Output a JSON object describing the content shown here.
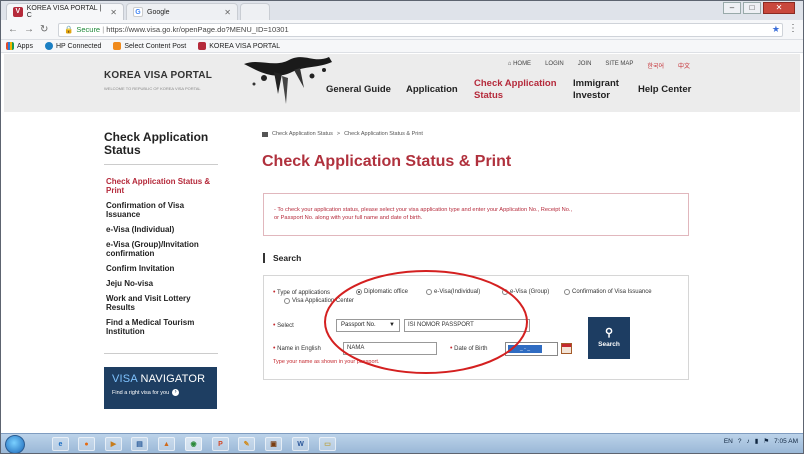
{
  "browser": {
    "tabs": [
      {
        "title": "KOREA VISA PORTAL | C",
        "favicon": "korea-visa-favicon",
        "active": true
      },
      {
        "title": "Google",
        "favicon": "google-favicon",
        "active": false
      }
    ],
    "address": {
      "secure_label": "Secure",
      "url": "https://www.visa.go.kr/openPage.do?MENU_ID=10301"
    },
    "bookmarks": [
      {
        "label": "Apps",
        "icon": "apps-grid-icon"
      },
      {
        "label": "HP Connected",
        "icon": "hp-icon"
      },
      {
        "label": "Select Content Post",
        "icon": "content-post-icon"
      },
      {
        "label": "KOREA VISA PORTAL",
        "icon": "korea-visa-favicon"
      }
    ]
  },
  "header": {
    "logo": "KOREA VISA PORTAL",
    "logo_sub": "WELCOME TO REPUBLIC OF KOREA VISA PORTAL",
    "util": {
      "home": "HOME",
      "login": "LOGIN",
      "join": "JOIN",
      "sitemap": "SITE MAP",
      "korean": "한국어",
      "chinese": "中文"
    },
    "nav": {
      "general": "General Guide",
      "application": "Application",
      "check_line1": "Check Application",
      "check_line2": "Status",
      "immigrant_line1": "Immigrant",
      "immigrant_line2": "Investor",
      "help": "Help Center"
    }
  },
  "sidebar": {
    "title": "Check Application Status",
    "items": [
      "Check Application Status & Print",
      "Confirmation of Visa Issuance",
      "e-Visa (Individual)",
      "e-Visa (Group)/Invitation confirmation",
      "Confirm Invitation",
      "Jeju No-visa",
      "Work and Visit Lottery Results",
      "Find a Medical Tourism Institution"
    ],
    "visa_nav": {
      "v": "VISA",
      "rest": " NAVIGATOR",
      "sub": "Find a right visa for you"
    }
  },
  "main": {
    "breadcrumb": [
      "Check Application Status",
      "Check Application Status & Print"
    ],
    "title": "Check Application Status & Print",
    "info": "- To check your application status, please select your visa application type and enter your Application No., Receipt No., or Passport No. along with your full name and date of birth.",
    "search_heading": "Search",
    "form": {
      "type_label": "Type of applications",
      "options": [
        "Diplomatic office",
        "e-Visa(Individual)",
        "e-Visa (Group)",
        "Confirmation of Visa Issuance",
        "Visa Application Center"
      ],
      "select_label": "Select",
      "select_value": "Passport No.",
      "passport_value": "ISI NOMOR PASSPORT",
      "name_label": "Name in English",
      "name_value": "NAMA",
      "dob_label": "Date of Birth",
      "dob_value": "_ - _",
      "search_button": "Search",
      "hint": "Type your name as shown in your passport."
    }
  },
  "taskbar": {
    "tray": {
      "lang": "EN",
      "time": "7:05 AM"
    }
  },
  "colors": {
    "brand_red": "#b0313d",
    "navy": "#1d3d62",
    "annotation_red": "#d42020"
  }
}
